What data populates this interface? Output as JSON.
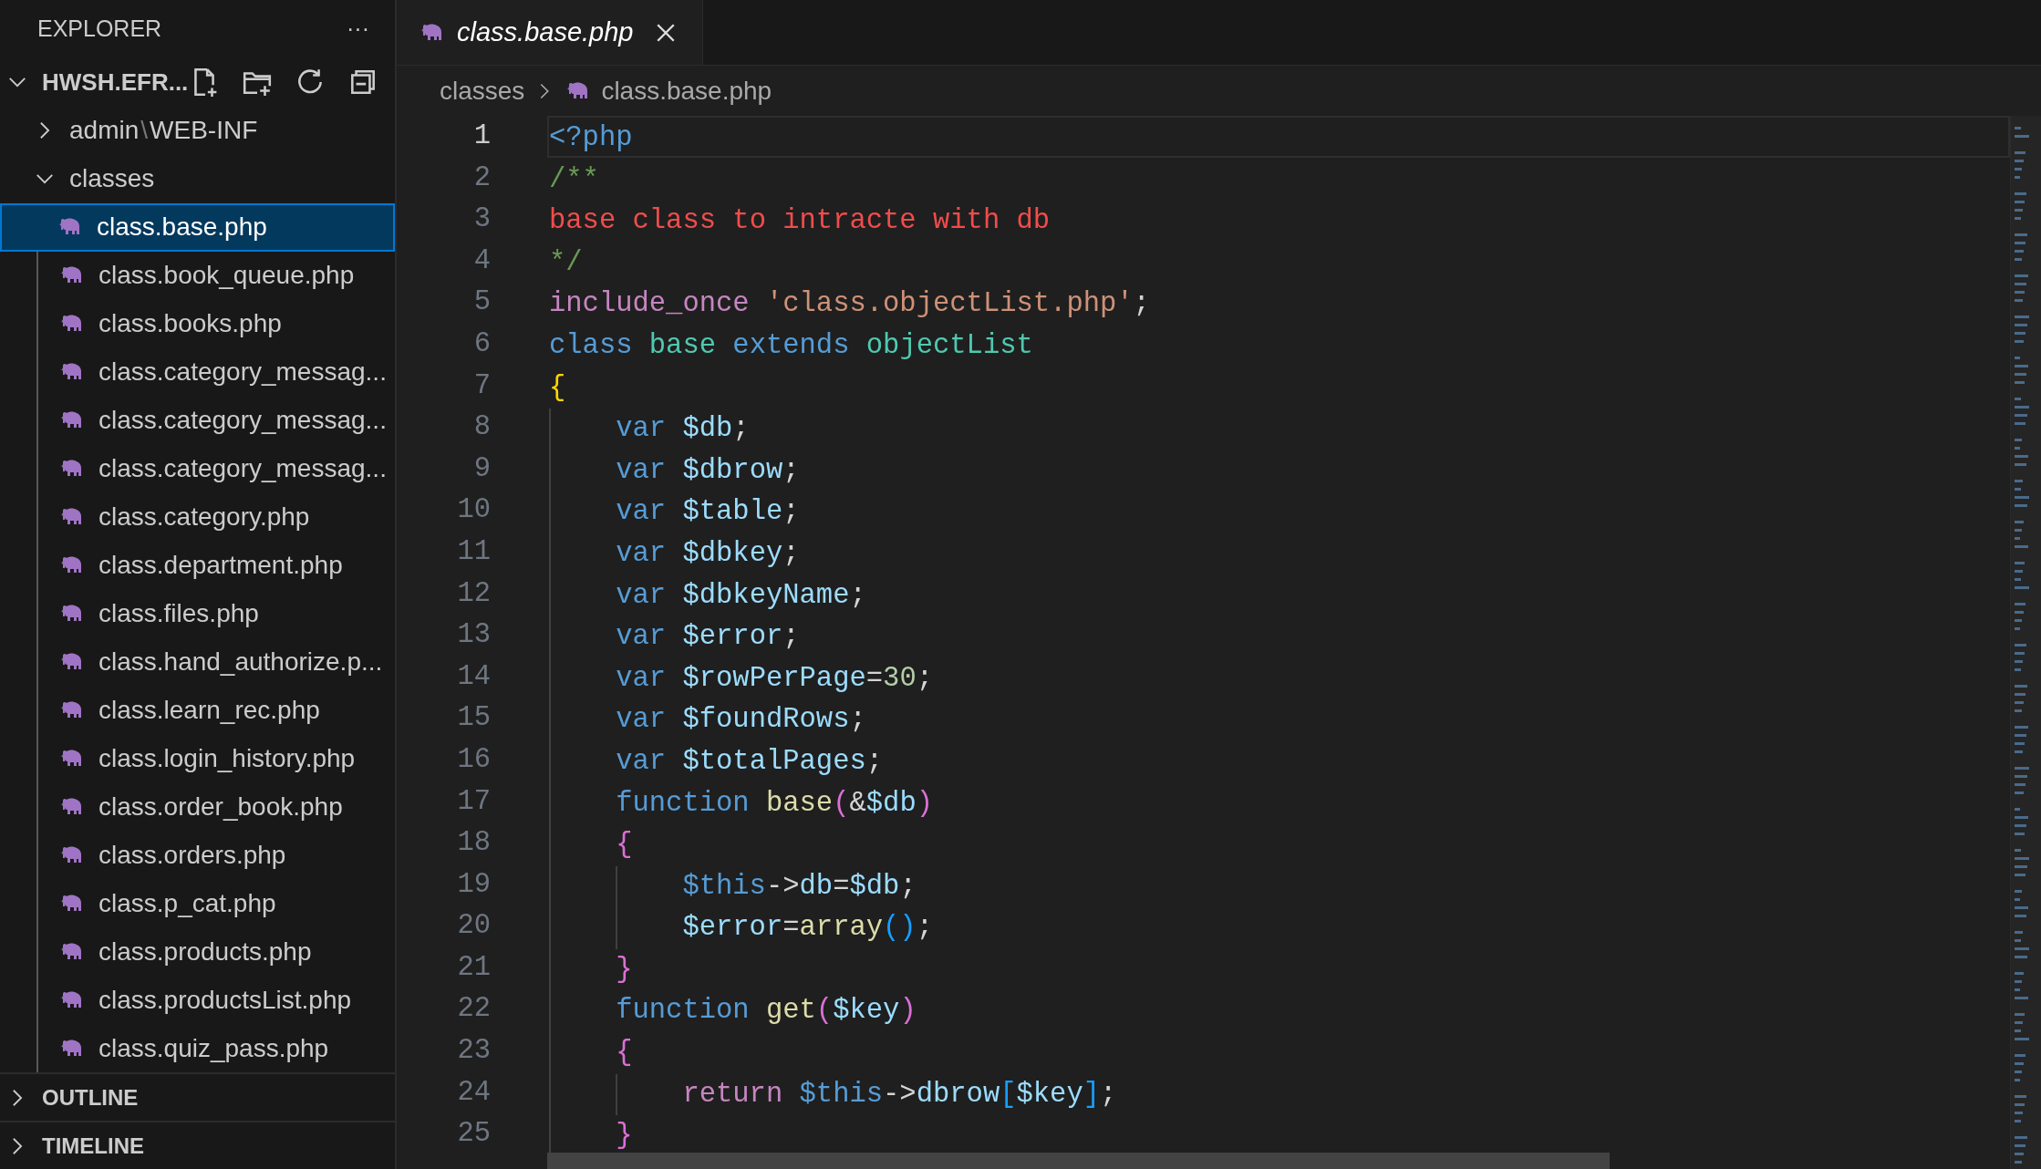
{
  "sidebar": {
    "title": "EXPLORER",
    "more": "···",
    "root": {
      "label": "HWSH.EFR...",
      "expanded": true,
      "children": [
        {
          "kind": "folder",
          "label": "admin",
          "separator": "\\",
          "compact_child": "WEB-INF",
          "expanded": false
        },
        {
          "kind": "folder",
          "label": "classes",
          "expanded": true,
          "children": [
            {
              "kind": "file",
              "label": "class.base.php",
              "selected": true
            },
            {
              "kind": "file",
              "label": "class.book_queue.php",
              "selected": false
            },
            {
              "kind": "file",
              "label": "class.books.php",
              "selected": false
            },
            {
              "kind": "file",
              "label": "class.category_messag...",
              "selected": false
            },
            {
              "kind": "file",
              "label": "class.category_messag...",
              "selected": false
            },
            {
              "kind": "file",
              "label": "class.category_messag...",
              "selected": false
            },
            {
              "kind": "file",
              "label": "class.category.php",
              "selected": false
            },
            {
              "kind": "file",
              "label": "class.department.php",
              "selected": false
            },
            {
              "kind": "file",
              "label": "class.files.php",
              "selected": false
            },
            {
              "kind": "file",
              "label": "class.hand_authorize.p...",
              "selected": false
            },
            {
              "kind": "file",
              "label": "class.learn_rec.php",
              "selected": false
            },
            {
              "kind": "file",
              "label": "class.login_history.php",
              "selected": false
            },
            {
              "kind": "file",
              "label": "class.order_book.php",
              "selected": false
            },
            {
              "kind": "file",
              "label": "class.orders.php",
              "selected": false
            },
            {
              "kind": "file",
              "label": "class.p_cat.php",
              "selected": false
            },
            {
              "kind": "file",
              "label": "class.products.php",
              "selected": false
            },
            {
              "kind": "file",
              "label": "class.productsList.php",
              "selected": false
            },
            {
              "kind": "file",
              "label": "class.quiz_pass.php",
              "selected": false
            }
          ]
        }
      ]
    },
    "sections": [
      {
        "label": "OUTLINE",
        "expanded": false
      },
      {
        "label": "TIMELINE",
        "expanded": false
      }
    ]
  },
  "tabs": [
    {
      "label": "class.base.php",
      "selected": true,
      "preview": true
    }
  ],
  "breadcrumb": [
    {
      "kind": "folder",
      "label": "classes"
    },
    {
      "kind": "file",
      "label": "class.base.php"
    }
  ],
  "editor": {
    "lines": [
      {
        "number": "1",
        "current": true,
        "tokens": [
          {
            "kind": "tag",
            "text": "<?php"
          }
        ]
      },
      {
        "number": "2",
        "current": false,
        "tokens": [
          {
            "kind": "comment",
            "text": "/**"
          }
        ]
      },
      {
        "number": "3",
        "current": false,
        "tokens": [
          {
            "kind": "error",
            "text": "base class to intracte with db"
          }
        ]
      },
      {
        "number": "4",
        "current": false,
        "tokens": [
          {
            "kind": "comment",
            "text": "*/"
          }
        ]
      },
      {
        "number": "5",
        "current": false,
        "tokens": [
          {
            "kind": "control",
            "text": "include_once"
          },
          {
            "kind": "string",
            "text": " 'class.objectList.php'"
          },
          {
            "kind": "punct",
            "text": ";"
          }
        ]
      },
      {
        "number": "6",
        "current": false,
        "tokens": [
          {
            "kind": "keyword",
            "text": "class"
          },
          {
            "kind": "type",
            "text": " base"
          },
          {
            "kind": "keyword",
            "text": " extends"
          },
          {
            "kind": "type",
            "text": " objectList"
          }
        ]
      },
      {
        "number": "7",
        "current": false,
        "tokens": [
          {
            "kind": "brace1",
            "text": "{"
          }
        ]
      },
      {
        "number": "8",
        "current": false,
        "tokens": [
          {
            "kind": "keyword",
            "text": "    var"
          },
          {
            "kind": "variable",
            "text": " $db"
          },
          {
            "kind": "punct",
            "text": ";"
          }
        ]
      },
      {
        "number": "9",
        "current": false,
        "tokens": [
          {
            "kind": "keyword",
            "text": "    var"
          },
          {
            "kind": "variable",
            "text": " $dbrow"
          },
          {
            "kind": "punct",
            "text": ";"
          }
        ]
      },
      {
        "number": "10",
        "current": false,
        "tokens": [
          {
            "kind": "keyword",
            "text": "    var"
          },
          {
            "kind": "variable",
            "text": " $table"
          },
          {
            "kind": "punct",
            "text": ";"
          }
        ]
      },
      {
        "number": "11",
        "current": false,
        "tokens": [
          {
            "kind": "keyword",
            "text": "    var"
          },
          {
            "kind": "variable",
            "text": " $dbkey"
          },
          {
            "kind": "punct",
            "text": ";"
          }
        ]
      },
      {
        "number": "12",
        "current": false,
        "tokens": [
          {
            "kind": "keyword",
            "text": "    var"
          },
          {
            "kind": "variable",
            "text": " $dbkeyName"
          },
          {
            "kind": "punct",
            "text": ";"
          }
        ]
      },
      {
        "number": "13",
        "current": false,
        "tokens": [
          {
            "kind": "keyword",
            "text": "    var"
          },
          {
            "kind": "variable",
            "text": " $error"
          },
          {
            "kind": "punct",
            "text": ";"
          }
        ]
      },
      {
        "number": "14",
        "current": false,
        "tokens": [
          {
            "kind": "keyword",
            "text": "    var"
          },
          {
            "kind": "variable",
            "text": " $rowPerPage"
          },
          {
            "kind": "punct",
            "text": "="
          },
          {
            "kind": "number",
            "text": "30"
          },
          {
            "kind": "punct",
            "text": ";"
          }
        ]
      },
      {
        "number": "15",
        "current": false,
        "tokens": [
          {
            "kind": "keyword",
            "text": "    var"
          },
          {
            "kind": "variable",
            "text": " $foundRows"
          },
          {
            "kind": "punct",
            "text": ";"
          }
        ]
      },
      {
        "number": "16",
        "current": false,
        "tokens": [
          {
            "kind": "keyword",
            "text": "    var"
          },
          {
            "kind": "variable",
            "text": " $totalPages"
          },
          {
            "kind": "punct",
            "text": ";"
          }
        ]
      },
      {
        "number": "17",
        "current": false,
        "tokens": [
          {
            "kind": "keyword",
            "text": "    function"
          },
          {
            "kind": "func",
            "text": " base"
          },
          {
            "kind": "brace2",
            "text": "("
          },
          {
            "kind": "punct",
            "text": "&"
          },
          {
            "kind": "variable",
            "text": "$db"
          },
          {
            "kind": "brace2",
            "text": ")"
          }
        ]
      },
      {
        "number": "18",
        "current": false,
        "tokens": [
          {
            "kind": "brace2",
            "text": "    {"
          }
        ]
      },
      {
        "number": "19",
        "current": false,
        "tokens": [
          {
            "kind": "this",
            "text": "        $this"
          },
          {
            "kind": "punct",
            "text": "->"
          },
          {
            "kind": "variable",
            "text": "db"
          },
          {
            "kind": "punct",
            "text": "="
          },
          {
            "kind": "variable",
            "text": "$db"
          },
          {
            "kind": "punct",
            "text": ";"
          }
        ]
      },
      {
        "number": "20",
        "current": false,
        "tokens": [
          {
            "kind": "variable",
            "text": "        $error"
          },
          {
            "kind": "punct",
            "text": "="
          },
          {
            "kind": "func",
            "text": "array"
          },
          {
            "kind": "brace3",
            "text": "()"
          },
          {
            "kind": "punct",
            "text": ";"
          }
        ]
      },
      {
        "number": "21",
        "current": false,
        "tokens": [
          {
            "kind": "brace2",
            "text": "    }"
          }
        ]
      },
      {
        "number": "22",
        "current": false,
        "tokens": [
          {
            "kind": "keyword",
            "text": "    function"
          },
          {
            "kind": "func",
            "text": " get"
          },
          {
            "kind": "brace2",
            "text": "("
          },
          {
            "kind": "variable",
            "text": "$key"
          },
          {
            "kind": "brace2",
            "text": ")"
          }
        ]
      },
      {
        "number": "23",
        "current": false,
        "tokens": [
          {
            "kind": "brace2",
            "text": "    {"
          }
        ]
      },
      {
        "number": "24",
        "current": false,
        "tokens": [
          {
            "kind": "control",
            "text": "        return"
          },
          {
            "kind": "this",
            "text": " $this"
          },
          {
            "kind": "punct",
            "text": "->"
          },
          {
            "kind": "variable",
            "text": "dbrow"
          },
          {
            "kind": "brace3",
            "text": "["
          },
          {
            "kind": "variable",
            "text": "$key"
          },
          {
            "kind": "brace3",
            "text": "]"
          },
          {
            "kind": "punct",
            "text": ";"
          }
        ]
      },
      {
        "number": "25",
        "current": false,
        "tokens": [
          {
            "kind": "brace2",
            "text": "    }"
          }
        ]
      }
    ]
  }
}
